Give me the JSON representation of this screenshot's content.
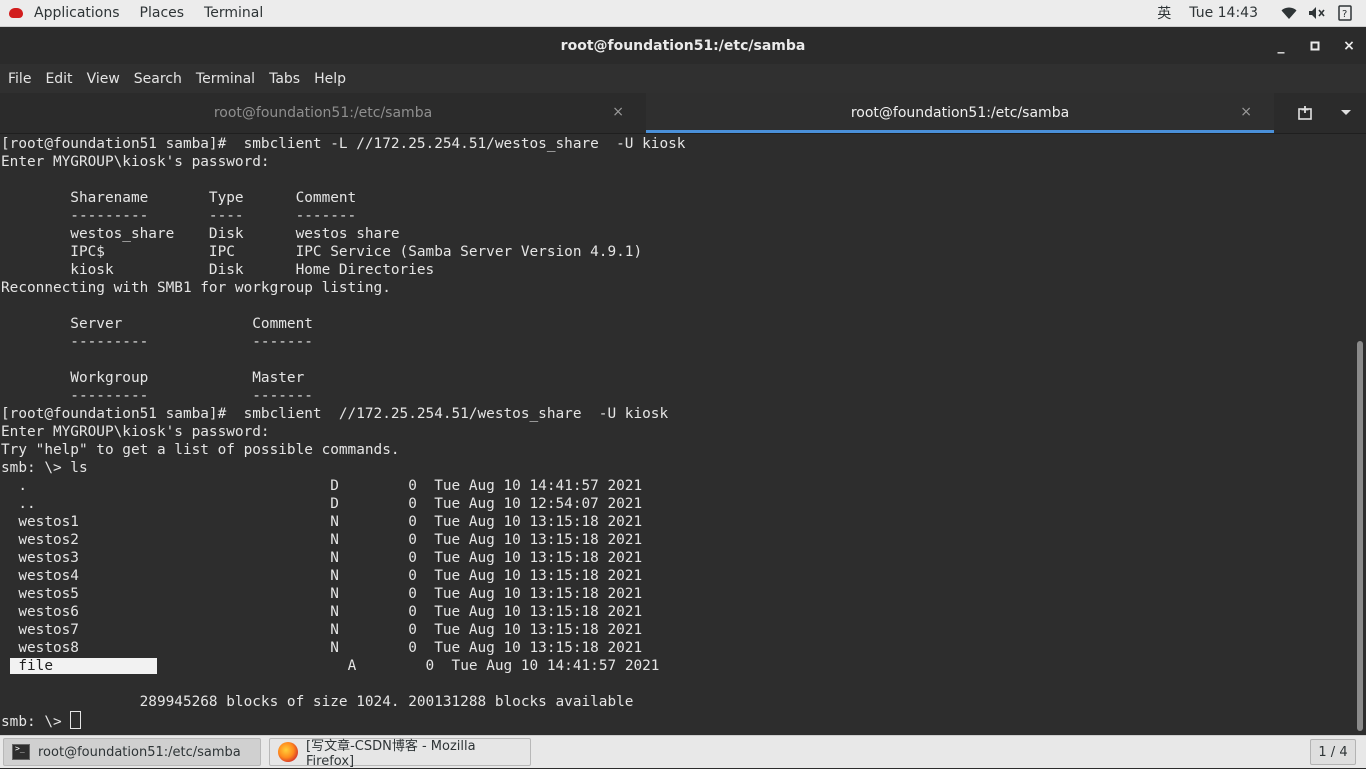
{
  "topbar": {
    "applications": "Applications",
    "places": "Places",
    "terminal": "Terminal",
    "input_method": "英",
    "clock": "Tue 14:43",
    "icons": [
      "wifi-icon",
      "volume-icon",
      "help-icon"
    ]
  },
  "window": {
    "title": "root@foundation51:/etc/samba",
    "minimize": "_",
    "maximize": "□",
    "close": "×"
  },
  "menubar": [
    "File",
    "Edit",
    "View",
    "Search",
    "Terminal",
    "Tabs",
    "Help"
  ],
  "tabs": [
    {
      "label": "root@foundation51:/etc/samba",
      "close": "×",
      "active": false
    },
    {
      "label": "root@foundation51:/etc/samba",
      "close": "×",
      "active": true
    }
  ],
  "terminal": {
    "lines_before_highlight": "[root@foundation51 samba]#  smbclient -L //172.25.254.51/westos_share  -U kiosk\nEnter MYGROUP\\kiosk's password: \n\n        Sharename       Type      Comment\n        ---------       ----      -------\n        westos_share    Disk      westos share\n        IPC$            IPC       IPC Service (Samba Server Version 4.9.1)\n        kiosk           Disk      Home Directories\nReconnecting with SMB1 for workgroup listing.\n\n        Server               Comment\n        ---------            -------\n\n        Workgroup            Master\n        ---------            -------\n[root@foundation51 samba]#  smbclient  //172.25.254.51/westos_share  -U kiosk\nEnter MYGROUP\\kiosk's password: \nTry \"help\" to get a list of possible commands.\nsmb: \\> ls\n  .                                   D        0  Tue Aug 10 14:41:57 2021\n  ..                                  D        0  Tue Aug 10 12:54:07 2021\n  westos1                             N        0  Tue Aug 10 13:15:18 2021\n  westos2                             N        0  Tue Aug 10 13:15:18 2021\n  westos3                             N        0  Tue Aug 10 13:15:18 2021\n  westos4                             N        0  Tue Aug 10 13:15:18 2021\n  westos5                             N        0  Tue Aug 10 13:15:18 2021\n  westos6                             N        0  Tue Aug 10 13:15:18 2021\n  westos7                             N        0  Tue Aug 10 13:15:18 2021\n  westos8                             N        0  Tue Aug 10 13:15:18 2021\n",
    "highlight_prefix": " ",
    "highlight_text": " file            ",
    "highlight_suffix": "                      A        0  Tue Aug 10 14:41:57 2021\n\n                289945268 blocks of size 1024. 200131288 blocks available\n",
    "prompt": "smb: \\> "
  },
  "taskbar": {
    "items": [
      {
        "label": "root@foundation51:/etc/samba",
        "icon": "terminal-icon"
      },
      {
        "label": "[写文章-CSDN博客 - Mozilla Firefox]",
        "icon": "firefox-icon"
      }
    ],
    "workspace": "1 / 4"
  }
}
